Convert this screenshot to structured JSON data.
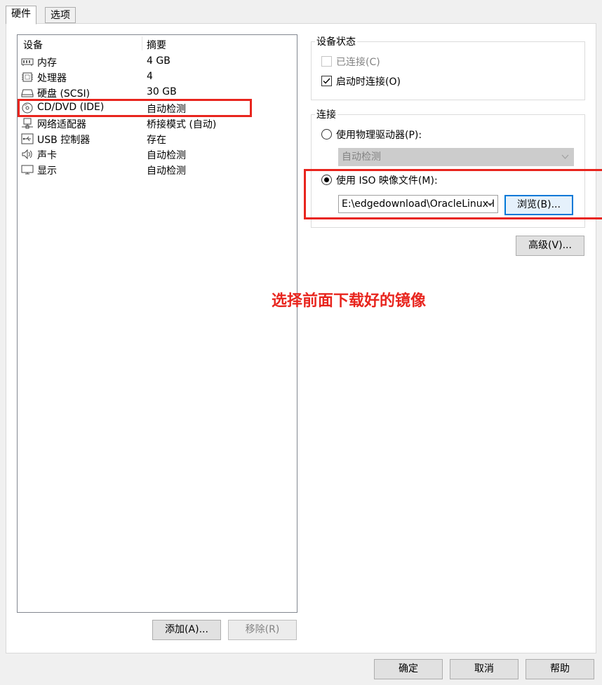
{
  "tabs": [
    {
      "label": "硬件",
      "active": true
    },
    {
      "label": "选项",
      "active": false
    }
  ],
  "device_list": {
    "headers": {
      "device": "设备",
      "summary": "摘要"
    },
    "items": [
      {
        "name": "内存",
        "summary": "4 GB",
        "icon": "memory-icon"
      },
      {
        "name": "处理器",
        "summary": "4",
        "icon": "cpu-icon"
      },
      {
        "name": "硬盘 (SCSI)",
        "summary": "30 GB",
        "icon": "hard-disk-icon"
      },
      {
        "name": "CD/DVD (IDE)",
        "summary": "自动检测",
        "icon": "cd-dvd-icon"
      },
      {
        "name": "网络适配器",
        "summary": "桥接模式 (自动)",
        "icon": "network-adapter-icon"
      },
      {
        "name": "USB 控制器",
        "summary": "存在",
        "icon": "usb-icon"
      },
      {
        "name": "声卡",
        "summary": "自动检测",
        "icon": "speaker-icon"
      },
      {
        "name": "显示",
        "summary": "自动检测",
        "icon": "monitor-icon"
      }
    ]
  },
  "list_buttons": {
    "add": "添加(A)...",
    "remove": "移除(R)"
  },
  "device_status": {
    "title": "设备状态",
    "connected": {
      "label": "已连接(C)",
      "checked": false,
      "disabled": true
    },
    "connect_at_power_on": {
      "label": "启动时连接(O)",
      "checked": true
    }
  },
  "connection": {
    "title": "连接",
    "physical": {
      "label": "使用物理驱动器(P):",
      "selected": false,
      "dropdown_value": "自动检测"
    },
    "iso": {
      "label": "使用 ISO 映像文件(M):",
      "selected": true,
      "path_value": "E:\\edgedownload\\OracleLinux-I",
      "browse_label": "浏览(B)..."
    }
  },
  "advanced_button": "高级(V)...",
  "annotation": "选择前面下载好的镜像",
  "dialog_buttons": {
    "ok": "确定",
    "cancel": "取消",
    "help": "帮助"
  },
  "colors": {
    "highlight": "#e8251e",
    "focus_border": "#0078d7"
  }
}
